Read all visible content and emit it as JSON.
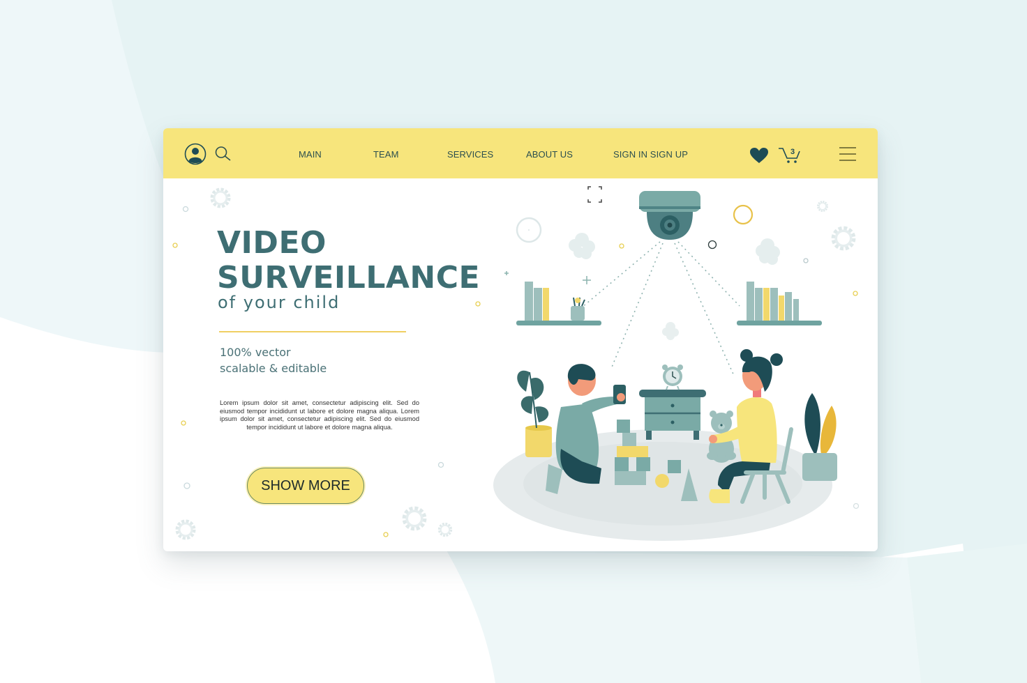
{
  "nav": {
    "links": [
      {
        "label": "MAIN"
      },
      {
        "label": "TEAM"
      },
      {
        "label": "SERVICES"
      },
      {
        "label": "ABOUT US"
      },
      {
        "label": "SIGN IN SIGN UP"
      }
    ],
    "icons": {
      "profile": "user-profile-icon",
      "search": "search-icon",
      "favorites": "heart-icon",
      "cart": "shopping-cart-icon",
      "menu": "hamburger-menu-icon"
    },
    "cart_count": "3"
  },
  "hero": {
    "title_line1": "VIDEO",
    "title_line2": "SURVEILLANCE",
    "subtitle": "of your child",
    "feature_line1": "100% vector",
    "feature_line2": "scalable & editable",
    "body": "Lorem ipsum dolor sit amet, consectetur adipiscing elit. Sed do eiusmod tempor incididunt ut labore et dolore magna aliqua. Lorem ipsum dolor sit amet, consectetur adipiscing elit. Sed do eiusmod tempor incididunt ut labore et dolore magna aliqua.",
    "cta_label": "SHOW MORE"
  },
  "illustration": {
    "description": "Dome security camera watching two children playing with blocks and a teddy bear",
    "elements": [
      "security-camera",
      "bookshelf-left",
      "bookshelf-right",
      "boy",
      "girl",
      "nightstand",
      "alarm-clock",
      "teddy-bear",
      "building-blocks",
      "potted-plant-left",
      "potted-plant-right",
      "chair",
      "rug"
    ]
  },
  "colors": {
    "navbar": "#f7e57c",
    "primary_teal": "#3e6e73",
    "dark_teal": "#1e4c55",
    "light_teal": "#7fb0ab",
    "accent_yellow": "#f7e57c",
    "divider": "#f0cf62",
    "background_tint": "#e6f3f4"
  }
}
